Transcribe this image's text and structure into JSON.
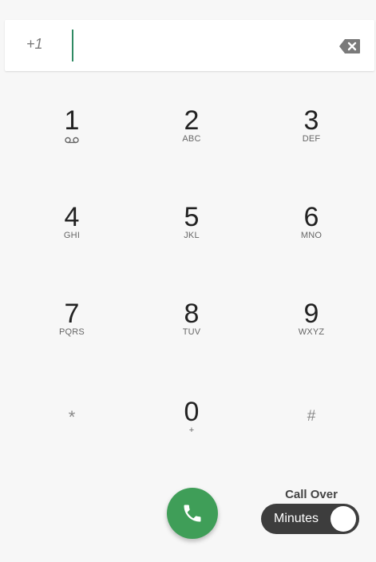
{
  "dialer": {
    "country_code": "+1",
    "number_value": "",
    "icons": {
      "backspace": "backspace-icon",
      "voicemail": "voicemail-icon",
      "call": "phone-icon"
    },
    "keys": [
      {
        "digit": "1",
        "sub": ""
      },
      {
        "digit": "2",
        "sub": "ABC"
      },
      {
        "digit": "3",
        "sub": "DEF"
      },
      {
        "digit": "4",
        "sub": "GHI"
      },
      {
        "digit": "5",
        "sub": "JKL"
      },
      {
        "digit": "6",
        "sub": "MNO"
      },
      {
        "digit": "7",
        "sub": "PQRS"
      },
      {
        "digit": "8",
        "sub": "TUV"
      },
      {
        "digit": "9",
        "sub": "WXYZ"
      },
      {
        "digit": "*",
        "sub": ""
      },
      {
        "digit": "0",
        "sub": "+"
      },
      {
        "digit": "#",
        "sub": ""
      }
    ]
  },
  "call_over": {
    "label": "Call Over",
    "toggle_label": "Minutes",
    "enabled": true
  },
  "colors": {
    "accent": "#3f9e58",
    "cursor": "#2f8a63",
    "toggle_bg": "#3d3d3d",
    "background": "#f7f7f7"
  }
}
